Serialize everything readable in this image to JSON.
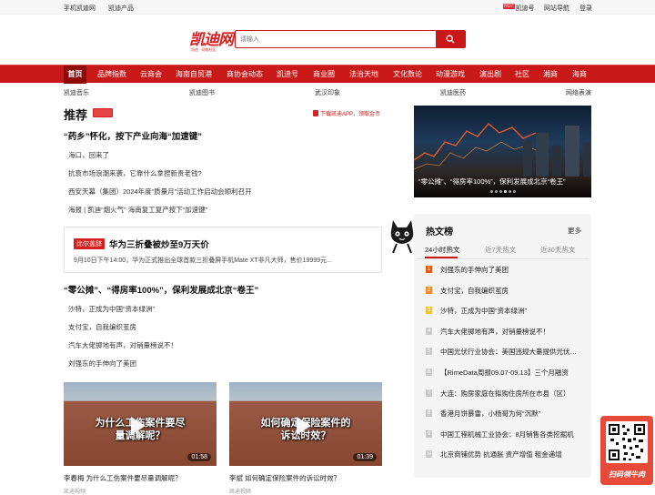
{
  "topbar": {
    "mobile": "手机凯迪网",
    "products": "凯迪产品",
    "hot_badge": "HOT",
    "kaidihao": "凯迪号",
    "site_nav": "网站导航",
    "login": "登录"
  },
  "logo": {
    "name": "凯迪网",
    "slogan": "凯迪 · 网络社区"
  },
  "search": {
    "placeholder": "请输入"
  },
  "nav": [
    "首页",
    "品牌指数",
    "云商会",
    "海南自贸港",
    "商协会动态",
    "凯迪号",
    "商业圈",
    "法治天地",
    "文化数论",
    "动漫游戏",
    "演出剧",
    "社区",
    "湘商",
    "海商"
  ],
  "subnav": [
    "凯迪音乐",
    "凯迪图书",
    "武汉印象",
    "凯迪医药",
    "网络表演"
  ],
  "recommend": {
    "title": "推荐",
    "download": "下载凯迪APP，领取金币",
    "headline1": "“药乡”怀化，按下产业向海“加速键”",
    "list1": [
      "海口，回来了",
      "抗衰市场浪潮来袭，它靠什么拿捏新贵老钱?",
      "西安天幕（集团）2024年度“质量月”活动工作启动会顺利召开",
      "海报 | 凯迪“烟火气” 海南复工复产按下“加速键”"
    ],
    "card": {
      "badge": "比尔盖辞",
      "title": "华为三折叠被炒至9万天价",
      "desc": "9月10日下午14:00，华为正式推出全球首款三折叠屏手机Mate XT非凡大师，售价19999元..."
    },
    "headline2": "“零公摊”、“得房率100%”，保利发展成北京“卷王”",
    "list2": [
      "沙特，正成为中国“资本绿洲”",
      "支付宝，自我编织茧房",
      "汽车大佬掷地有声，对销量榜说不！",
      "刘强东的手伸向了美团"
    ]
  },
  "videos": [
    {
      "caption": "为什么工伤案件要尽量调解呢？",
      "caption_l1": "为什么工伤案件要尽",
      "caption_l2": "量调解呢？",
      "duration": "01:58",
      "title": "李春梅 为什么工伤案件要尽量调解呢？",
      "source": "凯迪视频"
    },
    {
      "caption": "如何确定保险案件的诉讼时效？",
      "caption_l1": "如何确定保险案件的",
      "caption_l2": "诉讼时效？",
      "duration": "01:39",
      "title": "李斌 如何确定保险案件的诉讼时效？",
      "source": "凯迪视频"
    }
  ],
  "banner": {
    "caption": "“零公摊”、“得房率100%”，保利发展成北京“卷王”"
  },
  "hotlist": {
    "title": "热文榜",
    "more": "更多",
    "tabs": [
      "24小时热文",
      "近7天热文",
      "近30天热文"
    ],
    "items": [
      {
        "rank": "1",
        "text": "刘强东的手伸向了美团"
      },
      {
        "rank": "2",
        "text": "支付宝，自我编织茧房"
      },
      {
        "rank": "3",
        "text": "沙特，正成为中国“资本绿洲”"
      },
      {
        "rank": "4",
        "text": "汽车大佬掷地有声，对销量榜说不！"
      },
      {
        "rank": "5",
        "text": "中国光伏行业协会：美国违规大量提供光伏补贴"
      },
      {
        "rank": "6",
        "text": "【RimeData周报09.07-09.13】三个月融资"
      },
      {
        "rank": "7",
        "text": "大连：购房家庭在拟购住房所在市县（区）"
      },
      {
        "rank": "8",
        "text": "香港月饼暴雷，小杨哥为何“沉默”"
      },
      {
        "rank": "9",
        "text": "中国工程机械工业协会：8月销售各类挖掘机"
      },
      {
        "rank": "10",
        "text": "北京商铺优势 抗通胀 资产增值 租金递增"
      }
    ]
  },
  "qr": {
    "label": "扫码领牛肉"
  },
  "colors": {
    "brand": "#c81818",
    "nav_active": "#8e0909"
  }
}
